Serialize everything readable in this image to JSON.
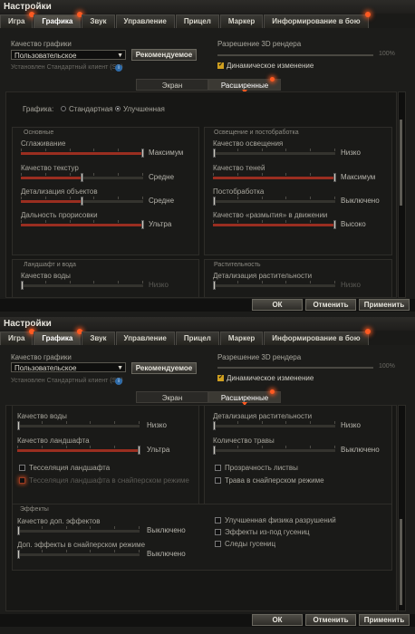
{
  "window": {
    "title": "Настройки"
  },
  "tabs": [
    {
      "label": "Игра",
      "badge": true
    },
    {
      "label": "Графика",
      "badge": true,
      "active": true
    },
    {
      "label": "Звук",
      "badge": false
    },
    {
      "label": "Управление",
      "badge": false
    },
    {
      "label": "Прицел",
      "badge": false
    },
    {
      "label": "Маркер",
      "badge": false
    },
    {
      "label": "Информирование в бою",
      "badge": true
    }
  ],
  "graphics": {
    "quality_label": "Качество графики",
    "quality_value": "Пользовательское",
    "recommended_button": "Рекомендуемое",
    "client_note": "Установлен Стандартный клиент (SD)",
    "info_icon": "i",
    "resolution_label": "Разрешение 3D рендера",
    "resolution_value": "100%",
    "dynamic_label": "Динамическое изменение"
  },
  "subtabs": {
    "screen": "Экран",
    "advanced": "Расширенные"
  },
  "mode": {
    "label": "Графика:",
    "standard": "Стандартная",
    "improved": "Улучшенная"
  },
  "groups": {
    "main": "Основные",
    "lighting": "Освещение и постобработка",
    "landscape": "Ландшафт и вода",
    "vegetation": "Растительность",
    "effects": "Эффекты"
  },
  "top_sliders": [
    {
      "label": "Сглаживание",
      "value": "Максимум",
      "level": 1.0
    },
    {
      "label": "Качество текстур",
      "value": "Средне",
      "level": 0.5
    },
    {
      "label": "Детализация объектов",
      "value": "Средне",
      "level": 0.5
    },
    {
      "label": "Дальность прорисовки",
      "value": "Ультра",
      "level": 1.0
    },
    {
      "label": "Качество освещения",
      "value": "Низко",
      "level": 0.0
    },
    {
      "label": "Качество теней",
      "value": "Максимум",
      "level": 1.0
    },
    {
      "label": "Постобработка",
      "value": "Выключено",
      "level": 0.0
    },
    {
      "label": "Качество «размытия» в движении",
      "value": "Высоко",
      "level": 1.0
    },
    {
      "label": "Качество воды",
      "value": "Низко",
      "level": 0.0
    },
    {
      "label": "Детализация растительности",
      "value": "Низко",
      "level": 0.0
    }
  ],
  "bottom_sliders": [
    {
      "label": "Качество воды",
      "value": "Низко",
      "level": 0.0
    },
    {
      "label": "Детализация растительности",
      "value": "Низко",
      "level": 0.0
    },
    {
      "label": "Качество ландшафта",
      "value": "Ультра",
      "level": 1.0
    },
    {
      "label": "Количество травы",
      "value": "Выключено",
      "level": 0.0
    },
    {
      "label": "Качество доп. эффектов",
      "value": "Выключено",
      "level": 0.0
    },
    {
      "label": "Доп. эффекты в снайперском режиме",
      "value": "Выключено",
      "level": 0.0
    }
  ],
  "checkboxes": {
    "tessellation": "Тесселяция ландшафта",
    "tessellation_sniper": "Тесселяция ландшафта в снайперском режиме",
    "transparent_foliage": "Прозрачность листвы",
    "grass_sniper": "Трава в снайперском режиме",
    "destruction_physics": "Улучшенная физика разрушений",
    "track_effects": "Эффекты из-под гусениц",
    "track_marks": "Следы гусениц"
  },
  "footer": {
    "ok": "ОК",
    "cancel": "Отменить",
    "apply": "Применить"
  },
  "colors": {
    "accent": "#ff5a22",
    "slider_fill": "#9a2e20",
    "checkbox_on": "#d0a020"
  }
}
